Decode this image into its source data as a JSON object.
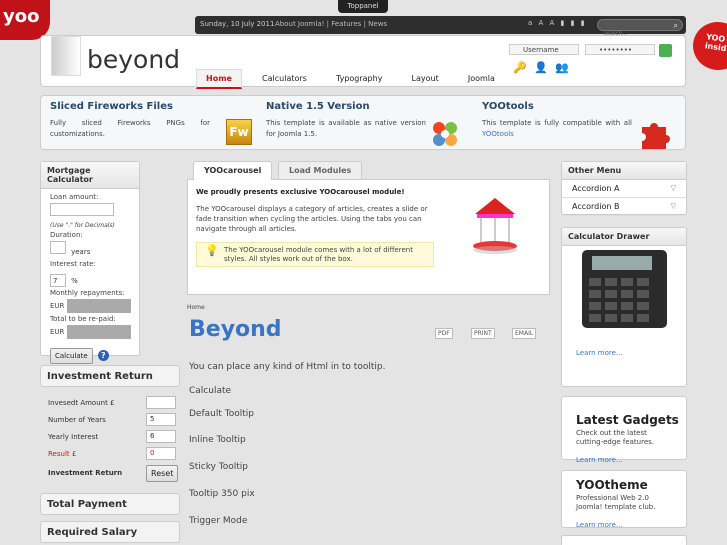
{
  "toppanel": {
    "label": "Toppanel"
  },
  "brand": {
    "corner": "yoo",
    "logo_text": "beyond",
    "badge": "YOO insid"
  },
  "topbar": {
    "date": "Sunday, 10 July 2011",
    "links": [
      "About Joomla!",
      "Features",
      "News"
    ],
    "font_sizer": "a A A",
    "search_placeholder": "search..."
  },
  "login": {
    "username_placeholder": "Username",
    "password_value": "••••••••"
  },
  "main_menu": [
    {
      "label": "Home",
      "active": true
    },
    {
      "label": "Calculators",
      "active": false
    },
    {
      "label": "Typography",
      "active": false
    },
    {
      "label": "Layout",
      "active": false
    },
    {
      "label": "Joomla",
      "active": false
    }
  ],
  "features": [
    {
      "title": "Sliced Fireworks Files",
      "text": "Fully sliced Fireworks PNGs for customizations.",
      "icon": "fireworks-icon",
      "icon_label": "Fw"
    },
    {
      "title": "Native 1.5 Version",
      "text": "This template is available as native version for Joomla 1.5.",
      "icon": "joomla-icon"
    },
    {
      "title": "YOOtools",
      "text_pre": "This template is fully compatible with all ",
      "link": "YOOtools",
      "icon": "puzzle-icon"
    }
  ],
  "mortgage": {
    "title": "Mortgage Calculator",
    "loan_amount": "Loan amount:",
    "hint": "(Use \".\" for Decimals)",
    "duration": "Duration:",
    "years": "years",
    "interest_rate": "Interest rate:",
    "interest_value": "7",
    "percent": "%",
    "monthly": "Monthly repayments:",
    "currency": "EUR",
    "total": "Total to be re-paid:",
    "calculate": "Calculate"
  },
  "investment": {
    "title": "Investment Return",
    "rows": [
      {
        "label": "Invesedt Amount £",
        "value": ""
      },
      {
        "label": "Number of Years",
        "value": "5"
      },
      {
        "label": "Yearly Interest",
        "value": "6"
      },
      {
        "label": "Result £",
        "value": "0"
      },
      {
        "label": "Investment Return",
        "value": ""
      }
    ],
    "reset": "Reset"
  },
  "side_headings": {
    "total_payment": "Total Payment",
    "required_salary": "Required Salary"
  },
  "tabs": {
    "items": [
      "YOOcarousel",
      "Load Modules"
    ],
    "heading": "We proudly presents exclusive YOOcarousel module!",
    "desc": "The YOOcarousel displays a category of articles, creates a slide or fade transition when cycling the articles. Using the tabs you can navigate through all articles.",
    "tip": "The YOOcarousel module comes with a lot of different styles. All styles work out of the box."
  },
  "article": {
    "breadcrumb": "Home",
    "title": "Beyond",
    "icons": [
      "PDF",
      "PRINT",
      "EMAIL"
    ],
    "lines": [
      "You can place any kind of Html in to tooltip.",
      "Calculate",
      "Default Tooltip",
      "Inline Tooltip",
      "Sticky Tooltip",
      "Tooltip 350 pix",
      "Trigger Mode"
    ]
  },
  "other_menu": {
    "title": "Other Menu",
    "items": [
      "Accordion A",
      "Accordion B"
    ]
  },
  "calculator_drawer": {
    "title": "Calculator Drawer",
    "learn_more": "Learn more..."
  },
  "cards": [
    {
      "title": "Latest Gadgets",
      "text": "Check out the latest cutting-edge features.",
      "link": "Learn more..."
    },
    {
      "title": "YOOtheme",
      "text": "Professional Web 2.0 Joomla! template club.",
      "link": "Learn more..."
    }
  ]
}
